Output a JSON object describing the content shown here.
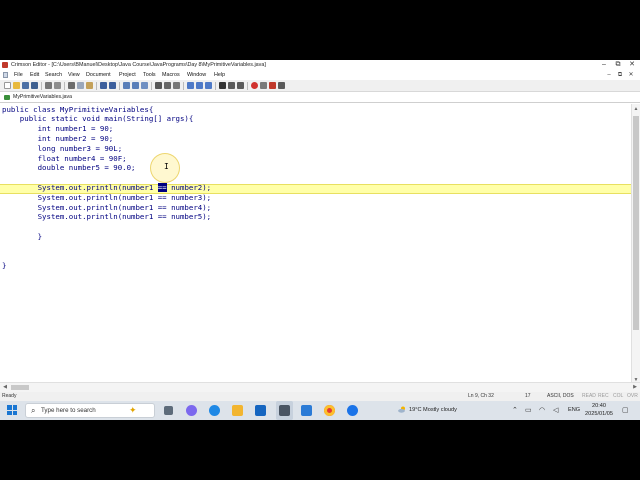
{
  "window": {
    "title": "Crimson Editor - [C:\\Users\\BManuel\\Desktop\\Java Course\\JavaPrograms\\Day 8\\MyPrimitiveVariables.java]",
    "buttons": {
      "minimize": "–",
      "maximize": "⧉",
      "close": "✕"
    }
  },
  "menu": {
    "items": [
      "File",
      "Edit",
      "Search",
      "View",
      "Document",
      "Project",
      "Tools",
      "Macros",
      "Window",
      "Help"
    ],
    "mdi": {
      "minimize": "–",
      "restore": "⧉",
      "close": "✕"
    }
  },
  "toolbar": {
    "icons": [
      "new-file-icon",
      "open-folder-icon",
      "save-icon",
      "save-all-icon",
      "print-icon",
      "print-preview-icon",
      "cut-icon",
      "copy-icon",
      "paste-icon",
      "undo-icon",
      "redo-icon",
      "find-icon",
      "find-next-icon",
      "replace-icon",
      "goto-icon",
      "column-mode-icon",
      "word-wrap-icon",
      "toggle-bookmark-icon",
      "next-bookmark-icon",
      "prev-bookmark-icon",
      "word-wrap-w-icon",
      "indent-icon",
      "unindent-icon",
      "record-macro-icon",
      "stop-macro-icon",
      "play-macro-icon",
      "dir-tree-icon"
    ]
  },
  "tab": {
    "label": "MyPrimitiveVariables.java"
  },
  "editor": {
    "lines": [
      {
        "before": "public class MyPrimitiveVariables{",
        "selected": "",
        "after": ""
      },
      {
        "before": "    public static void main(String[] args){",
        "selected": "",
        "after": ""
      },
      {
        "before": "        int number1 = 90;",
        "selected": "",
        "after": ""
      },
      {
        "before": "        int number2 = 90;",
        "selected": "",
        "after": ""
      },
      {
        "before": "        long number3 = 90L;",
        "selected": "",
        "after": ""
      },
      {
        "before": "        float number4 = 90F;",
        "selected": "",
        "after": ""
      },
      {
        "before": "        double number5 = 90.0;",
        "selected": "",
        "after": ""
      },
      {
        "before": "",
        "selected": "",
        "after": ""
      },
      {
        "before": "        System.out.println(number1 ",
        "selected": "==",
        "after": " number2);"
      },
      {
        "before": "        System.out.println(number1 == number3);",
        "selected": "",
        "after": ""
      },
      {
        "before": "        System.out.println(number1 == number4);",
        "selected": "",
        "after": ""
      },
      {
        "before": "        System.out.println(number1 == number5);",
        "selected": "",
        "after": ""
      },
      {
        "before": "",
        "selected": "",
        "after": ""
      },
      {
        "before": "        }",
        "selected": "",
        "after": ""
      },
      {
        "before": "",
        "selected": "",
        "after": ""
      },
      {
        "before": "",
        "selected": "",
        "after": ""
      },
      {
        "before": "}",
        "selected": "",
        "after": ""
      }
    ],
    "cursor_glyph": "I"
  },
  "statusbar": {
    "ready": "Ready",
    "position": "Ln 9, Ch 32",
    "col": "17",
    "encoding": "ASCII, DOS",
    "flags": [
      "READ",
      "REC",
      "COL",
      "OVR"
    ]
  },
  "taskbar": {
    "search_placeholder": "Type here to search",
    "weather": "19°C  Mostly cloudy",
    "lang": "ENG",
    "time": "20:40",
    "date": "2025/01/05"
  },
  "colors": {
    "code": "#000080",
    "line_highlight": "#ffffa8",
    "selection": "#000080"
  }
}
